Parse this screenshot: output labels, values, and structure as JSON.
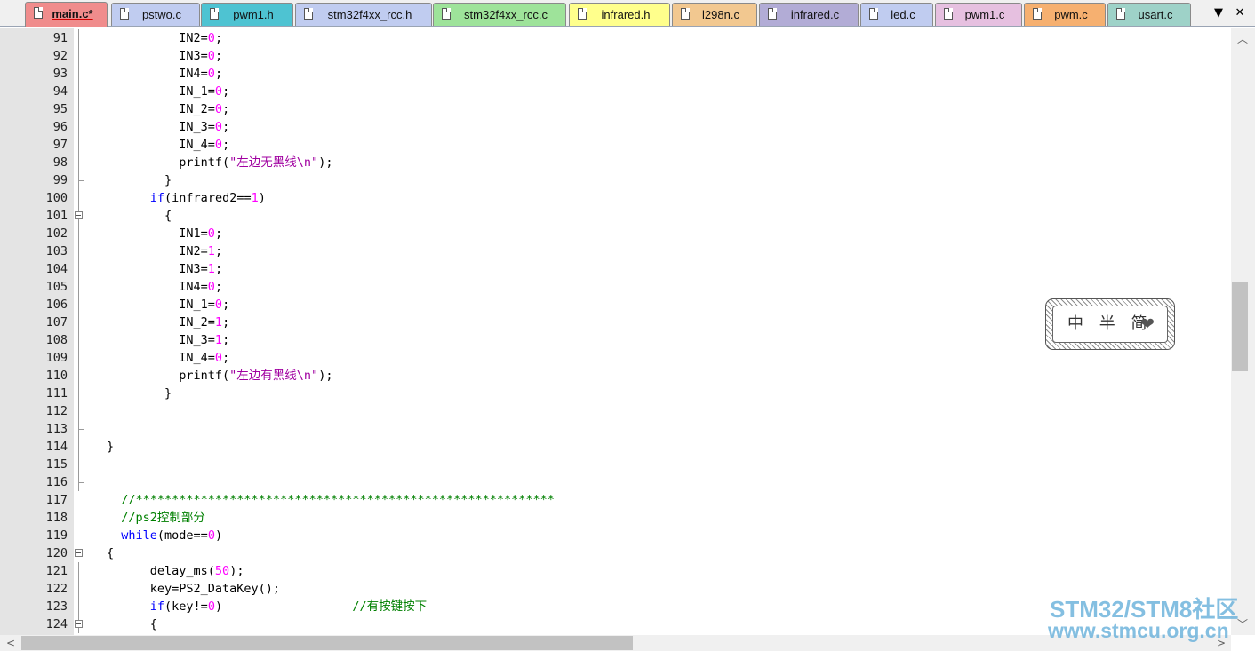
{
  "tabs": [
    {
      "label": "main.c*",
      "color": "#f08c8c",
      "active": true
    },
    {
      "label": "pstwo.c",
      "color": "#c0ccf0"
    },
    {
      "label": "pwm1.h",
      "color": "#4ec3d2"
    },
    {
      "label": "stm32f4xx_rcc.h",
      "color": "#c0ccf0"
    },
    {
      "label": "stm32f4xx_rcc.c",
      "color": "#9ee39a"
    },
    {
      "label": "infrared.h",
      "color": "#ffff8c"
    },
    {
      "label": "l298n.c",
      "color": "#f2c890"
    },
    {
      "label": "infrared.c",
      "color": "#b2acd6"
    },
    {
      "label": "led.c",
      "color": "#c0ccf0"
    },
    {
      "label": "pwm1.c",
      "color": "#e6c0e0"
    },
    {
      "label": "pwm.c",
      "color": "#f6b070"
    },
    {
      "label": "usart.c",
      "color": "#9ed2c8"
    }
  ],
  "tab_controls": {
    "dropdown": "▼",
    "close": "✕"
  },
  "code_lines": [
    {
      "n": "91",
      "t": [
        [
          "pl",
          "          IN2="
        ],
        [
          "num",
          "0"
        ],
        [
          "pl",
          ";"
        ]
      ]
    },
    {
      "n": "92",
      "t": [
        [
          "pl",
          "          IN3="
        ],
        [
          "num",
          "0"
        ],
        [
          "pl",
          ";"
        ]
      ]
    },
    {
      "n": "93",
      "t": [
        [
          "pl",
          "          IN4="
        ],
        [
          "num",
          "0"
        ],
        [
          "pl",
          ";"
        ]
      ]
    },
    {
      "n": "94",
      "t": [
        [
          "pl",
          "          IN_1="
        ],
        [
          "num",
          "0"
        ],
        [
          "pl",
          ";"
        ]
      ]
    },
    {
      "n": "95",
      "t": [
        [
          "pl",
          "          IN_2="
        ],
        [
          "num",
          "0"
        ],
        [
          "pl",
          ";"
        ]
      ]
    },
    {
      "n": "96",
      "t": [
        [
          "pl",
          "          IN_3="
        ],
        [
          "num",
          "0"
        ],
        [
          "pl",
          ";"
        ]
      ]
    },
    {
      "n": "97",
      "t": [
        [
          "pl",
          "          IN_4="
        ],
        [
          "num",
          "0"
        ],
        [
          "pl",
          ";"
        ]
      ]
    },
    {
      "n": "98",
      "t": [
        [
          "pl",
          "          printf("
        ],
        [
          "str",
          "\"左边无黑线\\n\""
        ],
        [
          "pl",
          ");"
        ]
      ]
    },
    {
      "n": "99",
      "t": [
        [
          "pl",
          "        }"
        ]
      ]
    },
    {
      "n": "100",
      "t": [
        [
          "pl",
          "      "
        ],
        [
          "kw",
          "if"
        ],
        [
          "pl",
          "(infrared2=="
        ],
        [
          "num",
          "1"
        ],
        [
          "pl",
          ")"
        ]
      ]
    },
    {
      "n": "101",
      "t": [
        [
          "pl",
          "        {"
        ]
      ]
    },
    {
      "n": "102",
      "t": [
        [
          "pl",
          "          IN1="
        ],
        [
          "num",
          "0"
        ],
        [
          "pl",
          ";"
        ]
      ]
    },
    {
      "n": "103",
      "t": [
        [
          "pl",
          "          IN2="
        ],
        [
          "num",
          "1"
        ],
        [
          "pl",
          ";"
        ]
      ]
    },
    {
      "n": "104",
      "t": [
        [
          "pl",
          "          IN3="
        ],
        [
          "num",
          "1"
        ],
        [
          "pl",
          ";"
        ]
      ]
    },
    {
      "n": "105",
      "t": [
        [
          "pl",
          "          IN4="
        ],
        [
          "num",
          "0"
        ],
        [
          "pl",
          ";"
        ]
      ]
    },
    {
      "n": "106",
      "t": [
        [
          "pl",
          "          IN_1="
        ],
        [
          "num",
          "0"
        ],
        [
          "pl",
          ";"
        ]
      ]
    },
    {
      "n": "107",
      "t": [
        [
          "pl",
          "          IN_2="
        ],
        [
          "num",
          "1"
        ],
        [
          "pl",
          ";"
        ]
      ]
    },
    {
      "n": "108",
      "t": [
        [
          "pl",
          "          IN_3="
        ],
        [
          "num",
          "1"
        ],
        [
          "pl",
          ";"
        ]
      ]
    },
    {
      "n": "109",
      "t": [
        [
          "pl",
          "          IN_4="
        ],
        [
          "num",
          "0"
        ],
        [
          "pl",
          ";"
        ]
      ]
    },
    {
      "n": "110",
      "t": [
        [
          "pl",
          "          printf("
        ],
        [
          "str",
          "\"左边有黑线\\n\""
        ],
        [
          "pl",
          ");"
        ]
      ]
    },
    {
      "n": "111",
      "t": [
        [
          "pl",
          "        }"
        ]
      ]
    },
    {
      "n": "112",
      "t": []
    },
    {
      "n": "113",
      "t": []
    },
    {
      "n": "114",
      "t": [
        [
          "pl",
          "}"
        ]
      ]
    },
    {
      "n": "115",
      "t": []
    },
    {
      "n": "116",
      "t": []
    },
    {
      "n": "117",
      "t": [
        [
          "cmt",
          "  //**********************************************************"
        ]
      ]
    },
    {
      "n": "118",
      "t": [
        [
          "cmt",
          "  //ps2控制部分"
        ]
      ]
    },
    {
      "n": "119",
      "t": [
        [
          "pl",
          "  "
        ],
        [
          "kw",
          "while"
        ],
        [
          "pl",
          "(mode=="
        ],
        [
          "num",
          "0"
        ],
        [
          "pl",
          ")"
        ]
      ]
    },
    {
      "n": "120",
      "t": [
        [
          "pl",
          "{"
        ]
      ]
    },
    {
      "n": "121",
      "t": [
        [
          "pl",
          "      delay_ms("
        ],
        [
          "num",
          "50"
        ],
        [
          "pl",
          ");"
        ]
      ]
    },
    {
      "n": "122",
      "t": [
        [
          "pl",
          "      key=PS2_DataKey();"
        ]
      ]
    },
    {
      "n": "123",
      "t": [
        [
          "pl",
          "      "
        ],
        [
          "kw",
          "if"
        ],
        [
          "pl",
          "(key!="
        ],
        [
          "num",
          "0"
        ],
        [
          "pl",
          ")                  "
        ],
        [
          "cmt",
          "//有按键按下"
        ]
      ]
    },
    {
      "n": "124",
      "t": [
        [
          "pl",
          "      {"
        ]
      ]
    }
  ],
  "ime": {
    "text": "中 半 简",
    "heart": "❤"
  },
  "watermark": {
    "line1": "STM32/STM8社区",
    "line2": "www.stmcu.org.cn"
  }
}
